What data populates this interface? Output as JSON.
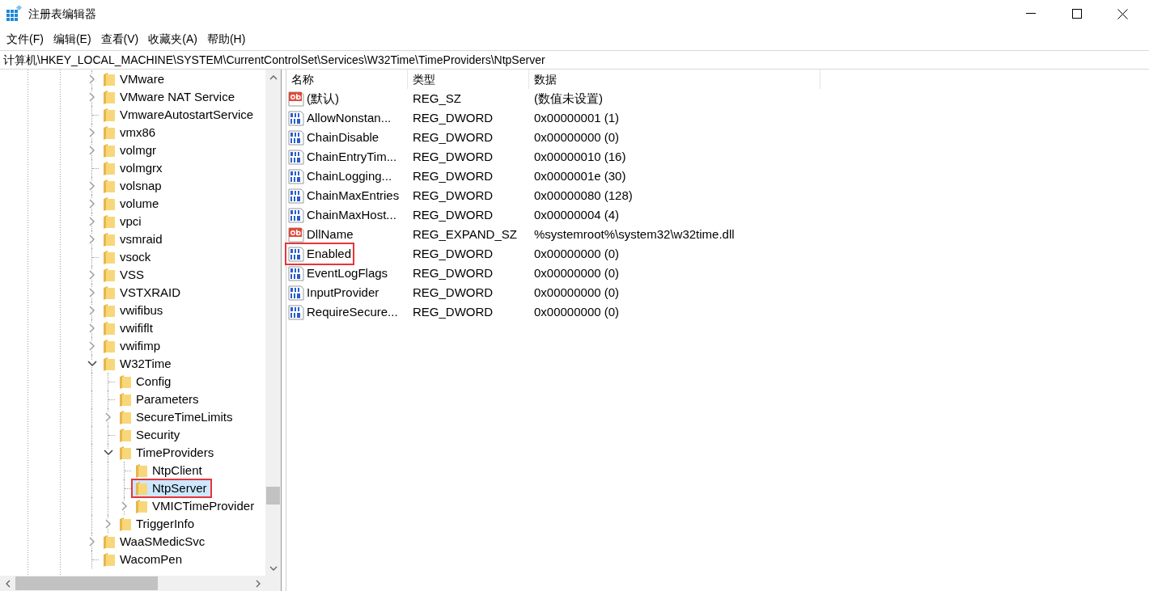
{
  "window": {
    "title": "注册表编辑器"
  },
  "menu": [
    "文件(F)",
    "编辑(E)",
    "查看(V)",
    "收藏夹(A)",
    "帮助(H)"
  ],
  "address": "计算机\\HKEY_LOCAL_MACHINE\\SYSTEM\\CurrentControlSet\\Services\\W32Time\\TimeProviders\\NtpServer",
  "tree": [
    {
      "label": "VMware",
      "kind": "branch",
      "expanded": false,
      "selected": false,
      "highlighted": false
    },
    {
      "label": "VMware NAT Service",
      "kind": "branch",
      "expanded": false,
      "selected": false,
      "highlighted": false
    },
    {
      "label": "VmwareAutostartService",
      "kind": "leaf",
      "selected": false,
      "highlighted": false
    },
    {
      "label": "vmx86",
      "kind": "branch",
      "expanded": false,
      "selected": false,
      "highlighted": false
    },
    {
      "label": "volmgr",
      "kind": "branch",
      "expanded": false,
      "selected": false,
      "highlighted": false
    },
    {
      "label": "volmgrx",
      "kind": "leaf",
      "selected": false,
      "highlighted": false
    },
    {
      "label": "volsnap",
      "kind": "branch",
      "expanded": false,
      "selected": false,
      "highlighted": false
    },
    {
      "label": "volume",
      "kind": "branch",
      "expanded": false,
      "selected": false,
      "highlighted": false
    },
    {
      "label": "vpci",
      "kind": "branch",
      "expanded": false,
      "selected": false,
      "highlighted": false
    },
    {
      "label": "vsmraid",
      "kind": "branch",
      "expanded": false,
      "selected": false,
      "highlighted": false
    },
    {
      "label": "vsock",
      "kind": "leaf",
      "selected": false,
      "highlighted": false
    },
    {
      "label": "VSS",
      "kind": "branch",
      "expanded": false,
      "selected": false,
      "highlighted": false
    },
    {
      "label": "VSTXRAID",
      "kind": "branch",
      "expanded": false,
      "selected": false,
      "highlighted": false
    },
    {
      "label": "vwifibus",
      "kind": "branch",
      "expanded": false,
      "selected": false,
      "highlighted": false
    },
    {
      "label": "vwififlt",
      "kind": "branch",
      "expanded": false,
      "selected": false,
      "highlighted": false
    },
    {
      "label": "vwifimp",
      "kind": "branch",
      "expanded": false,
      "selected": false,
      "highlighted": false
    },
    {
      "label": "W32Time",
      "kind": "branch",
      "expanded": true,
      "selected": false,
      "highlighted": false,
      "children": [
        {
          "label": "Config",
          "kind": "leaf",
          "selected": false,
          "highlighted": false
        },
        {
          "label": "Parameters",
          "kind": "leaf",
          "selected": false,
          "highlighted": false
        },
        {
          "label": "SecureTimeLimits",
          "kind": "branch",
          "expanded": false,
          "selected": false,
          "highlighted": false
        },
        {
          "label": "Security",
          "kind": "leaf",
          "selected": false,
          "highlighted": false
        },
        {
          "label": "TimeProviders",
          "kind": "branch",
          "expanded": true,
          "selected": false,
          "highlighted": false,
          "children": [
            {
              "label": "NtpClient",
              "kind": "leaf",
              "selected": false,
              "highlighted": false
            },
            {
              "label": "NtpServer",
              "kind": "leaf",
              "selected": true,
              "highlighted": true
            },
            {
              "label": "VMICTimeProvider",
              "kind": "branch",
              "expanded": false,
              "selected": false,
              "highlighted": false
            }
          ]
        },
        {
          "label": "TriggerInfo",
          "kind": "branch",
          "expanded": false,
          "selected": false,
          "highlighted": false
        }
      ]
    },
    {
      "label": "WaaSMedicSvc",
      "kind": "branch",
      "expanded": false,
      "selected": false,
      "highlighted": false
    },
    {
      "label": "WacomPen",
      "kind": "leaf",
      "selected": false,
      "highlighted": false
    }
  ],
  "table": {
    "columns": [
      "名称",
      "类型",
      "数据"
    ],
    "rows": [
      {
        "kind": "string",
        "name": "(默认)",
        "type": "REG_SZ",
        "data": "(数值未设置)",
        "highlighted": false
      },
      {
        "kind": "binary",
        "name": "AllowNonstan...",
        "type": "REG_DWORD",
        "data": "0x00000001 (1)",
        "highlighted": false
      },
      {
        "kind": "binary",
        "name": "ChainDisable",
        "type": "REG_DWORD",
        "data": "0x00000000 (0)",
        "highlighted": false
      },
      {
        "kind": "binary",
        "name": "ChainEntryTim...",
        "type": "REG_DWORD",
        "data": "0x00000010 (16)",
        "highlighted": false
      },
      {
        "kind": "binary",
        "name": "ChainLogging...",
        "type": "REG_DWORD",
        "data": "0x0000001e (30)",
        "highlighted": false
      },
      {
        "kind": "binary",
        "name": "ChainMaxEntries",
        "type": "REG_DWORD",
        "data": "0x00000080 (128)",
        "highlighted": false
      },
      {
        "kind": "binary",
        "name": "ChainMaxHost...",
        "type": "REG_DWORD",
        "data": "0x00000004 (4)",
        "highlighted": false
      },
      {
        "kind": "string",
        "name": "DllName",
        "type": "REG_EXPAND_SZ",
        "data": "%systemroot%\\system32\\w32time.dll",
        "highlighted": false
      },
      {
        "kind": "binary",
        "name": "Enabled",
        "type": "REG_DWORD",
        "data": "0x00000000 (0)",
        "highlighted": true
      },
      {
        "kind": "binary",
        "name": "EventLogFlags",
        "type": "REG_DWORD",
        "data": "0x00000000 (0)",
        "highlighted": false
      },
      {
        "kind": "binary",
        "name": "InputProvider",
        "type": "REG_DWORD",
        "data": "0x00000000 (0)",
        "highlighted": false
      },
      {
        "kind": "binary",
        "name": "RequireSecure...",
        "type": "REG_DWORD",
        "data": "0x00000000 (0)",
        "highlighted": false
      }
    ]
  }
}
